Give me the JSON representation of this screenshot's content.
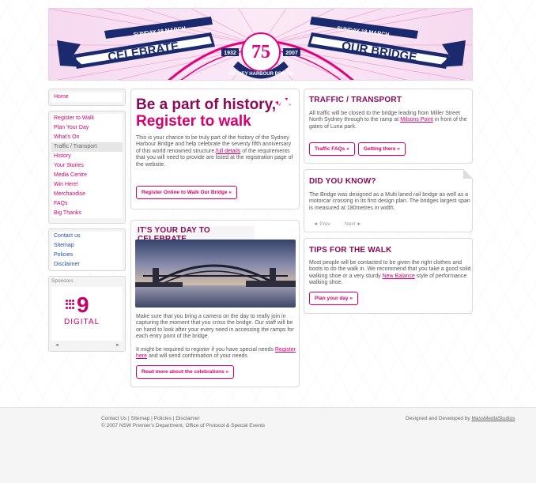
{
  "banner": {
    "left_ribbon_top": "SUNDAY 18 MARCH",
    "right_ribbon_top": "SUNDAY 18 MARCH",
    "left_ribbon_main": "CELEBRATE",
    "right_ribbon_main": "OUR BRIDGE",
    "badge_number": "75",
    "year_left": "1932",
    "year_right": "2007",
    "arc_text": "SYDNEY HARBOUR BRIDGE",
    "colors": {
      "pink": "#e3007d",
      "navy": "#1b2a6e",
      "purple": "#6a1b9a"
    }
  },
  "sidebar": {
    "home": "Home",
    "nav_items": [
      "Register to Walk",
      "Plan Your Day",
      "What's On",
      "Traffic / Transport",
      "History",
      "Your Stories",
      "Media Centre",
      "Win Here!",
      "Merchandise",
      "FAQs",
      "Big Thanks"
    ],
    "active_item": "Traffic / Transport",
    "utility_items": [
      "Contact us",
      "Sitemap",
      "Policies",
      "Disclaimer"
    ],
    "sponsors_heading": "Sponsors",
    "sponsor_logo_text": "DIGITAL",
    "sponsor_logo_number": "9",
    "prev_arrow": "◄",
    "next_arrow": "►"
  },
  "register_panel": {
    "title_line1": "Be a part of history,",
    "title_line2": "Register to walk",
    "body_before_link": "This is your chance to be truly part of  the history of the Sydney Harbour Bridge and help celebrate the seventy fifth anniversary of this world renowned structure.",
    "link_text": "full details",
    "body_after_link": " of the requirements that you will need to provide are listed at the registration page of the website.",
    "button_label": "Register Online to Walk Our Bridge »"
  },
  "celebrate_panel": {
    "title": "IT'S YOUR DAY TO CELEBRATE",
    "para1": "Make sure that you bring a camera on the day to really join in capturing the moment that you cross the bridge. Our staff will be on hand to look after your every need in accessing the ramps for each entry point of the bridge.",
    "para2_before_link": "It might be required to register if you have special needs ",
    "link_text": "Register here",
    "para2_after_link": " and will send confirmation of your needs",
    "button_label": "Read more about the celebrations »"
  },
  "traffic_panel": {
    "title": "TRAFFIC / TRANSPORT",
    "body_before_link": "All traffic will be closed to the bridge leading from Miller Street North Sydney through to the ramp at ",
    "link_text": "Milsons Point",
    "body_after_link": " in front of the gates of  Luna park.",
    "button1_label": "Traffic FAQs »",
    "button2_label": "Getting there »"
  },
  "did_you_know_panel": {
    "title": "DID YOU KNOW?",
    "body": "The Bridge was designed as a Multi laned rail bridge as well as a motorcar crossing in its first design plan. The bridges largest span is measured at 180metres in width.",
    "prev_label": "◄ Prev",
    "next_label": "Next ►"
  },
  "tips_panel": {
    "title": "TIPS FOR THE WALK",
    "body_before_link": "Most people will be contacted to be given the right clothes and boots to do the walk in. We recommend that you take a good solid walking shoe or a very sturdy ",
    "link_text": "New Balance",
    "body_after_link": " style of performance walking shoe.",
    "button_label": "Plan your day »"
  },
  "footer": {
    "links": [
      "Contact Us",
      "Sitemap",
      "Policies",
      "Disclaimer"
    ],
    "copyright": "© 2007 NSW Premier's Department, Office of Protocol & Special Events",
    "credit_prefix": "Designed and Developed by ",
    "credit_link": "MassMediaStudios"
  }
}
